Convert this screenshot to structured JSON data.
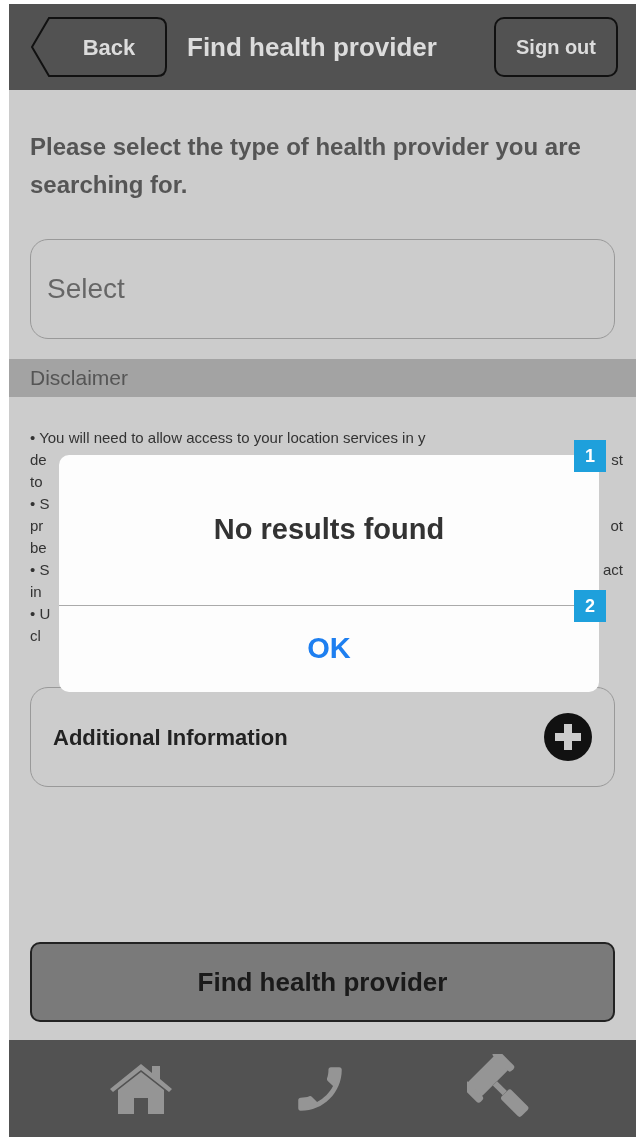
{
  "header": {
    "back": "Back",
    "title": "Find health provider",
    "sign_out": "Sign out"
  },
  "prompt": "Please select the type of health provider you are searching for.",
  "select": {
    "placeholder": "Select"
  },
  "disclaimer": {
    "title": "Disclaimer",
    "lines": [
      {
        "left": "• You will need to allow access to your location services in y"
      },
      {
        "left": "de",
        "right": "st"
      },
      {
        "left": "to"
      },
      {
        "left": "• S"
      },
      {
        "left": "pr",
        "right": "ot"
      },
      {
        "left": "be"
      },
      {
        "left": "• S",
        "right": "act"
      },
      {
        "left": "in"
      },
      {
        "left": "• U"
      },
      {
        "left": "cl"
      }
    ]
  },
  "additional": {
    "label": "Additional Information",
    "expanded": false
  },
  "find_button": "Find health provider",
  "dialog": {
    "message": "No results found",
    "button": "OK",
    "markers": [
      "1",
      "2"
    ]
  },
  "nav": [
    {
      "kind": "home"
    },
    {
      "kind": "phone"
    },
    {
      "kind": "gavel"
    }
  ]
}
